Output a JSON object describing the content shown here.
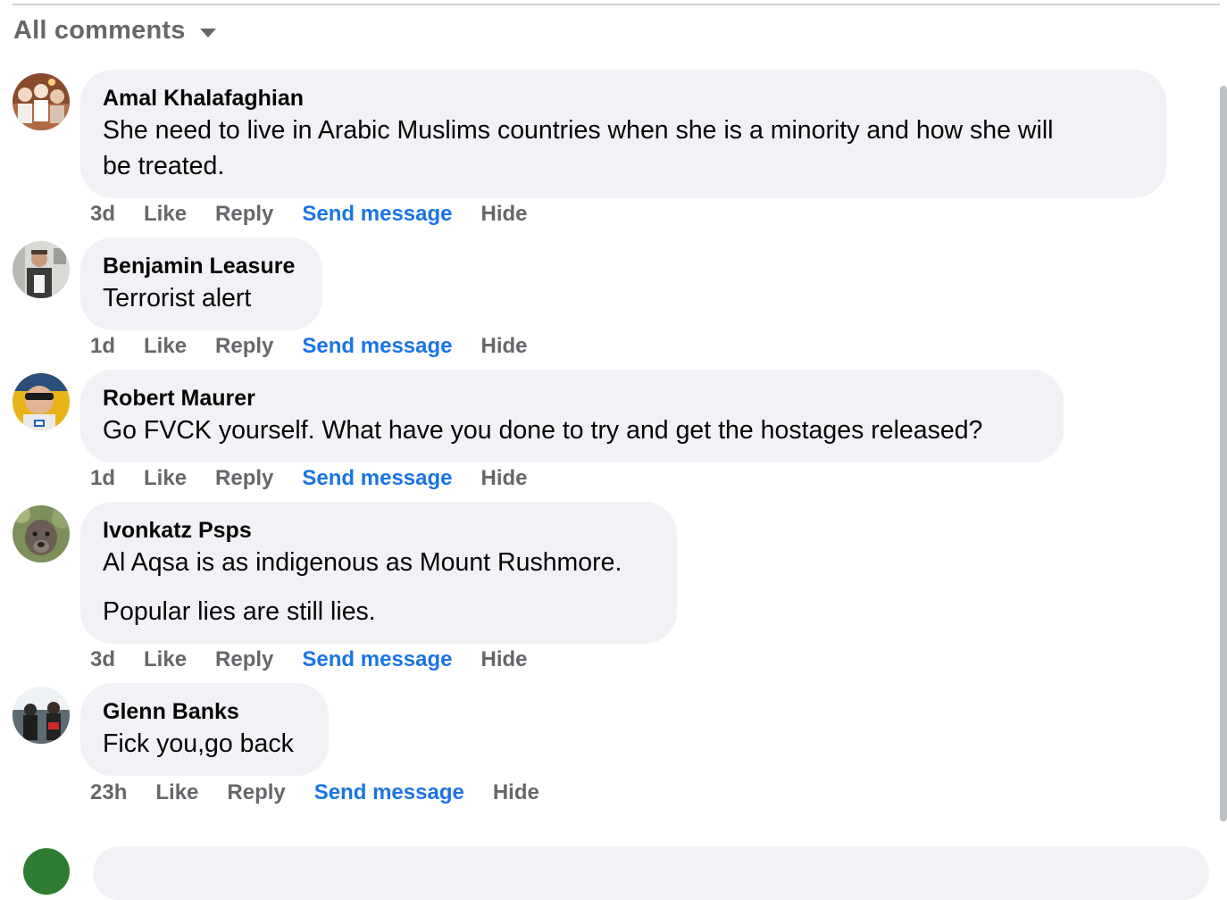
{
  "filter": {
    "label": "All comments",
    "icon": "caret-down-icon"
  },
  "comments": [
    {
      "author": "Amal Khalafaghian",
      "lines": [
        "She need to live in Arabic Muslims countries when she is a minority and how she will",
        "be treated."
      ],
      "time": "3d",
      "like": "Like",
      "reply": "Reply",
      "send": "Send message",
      "hide": "Hide"
    },
    {
      "author": "Benjamin Leasure",
      "lines": [
        "Terrorist alert"
      ],
      "time": "1d",
      "like": "Like",
      "reply": "Reply",
      "send": "Send message",
      "hide": "Hide"
    },
    {
      "author": "Robert Maurer",
      "lines": [
        "Go FVCK yourself. What have you done to try and get the hostages released?"
      ],
      "time": "1d",
      "like": "Like",
      "reply": "Reply",
      "send": "Send message",
      "hide": "Hide"
    },
    {
      "author": "Ivonkatz Psps",
      "lines": [
        "Al Aqsa is as indigenous as Mount Rushmore."
      ],
      "lines2": [
        "Popular lies are still lies."
      ],
      "time": "3d",
      "like": "Like",
      "reply": "Reply",
      "send": "Send message",
      "hide": "Hide"
    },
    {
      "author": "Glenn Banks",
      "lines": [
        "Fick you,go back"
      ],
      "time": "23h",
      "like": "Like",
      "reply": "Reply",
      "send": "Send message",
      "hide": "Hide"
    }
  ],
  "colors": {
    "bubble": "#f0f2f5",
    "muted": "#65676b",
    "link": "#1b74e4",
    "text": "#050505"
  }
}
